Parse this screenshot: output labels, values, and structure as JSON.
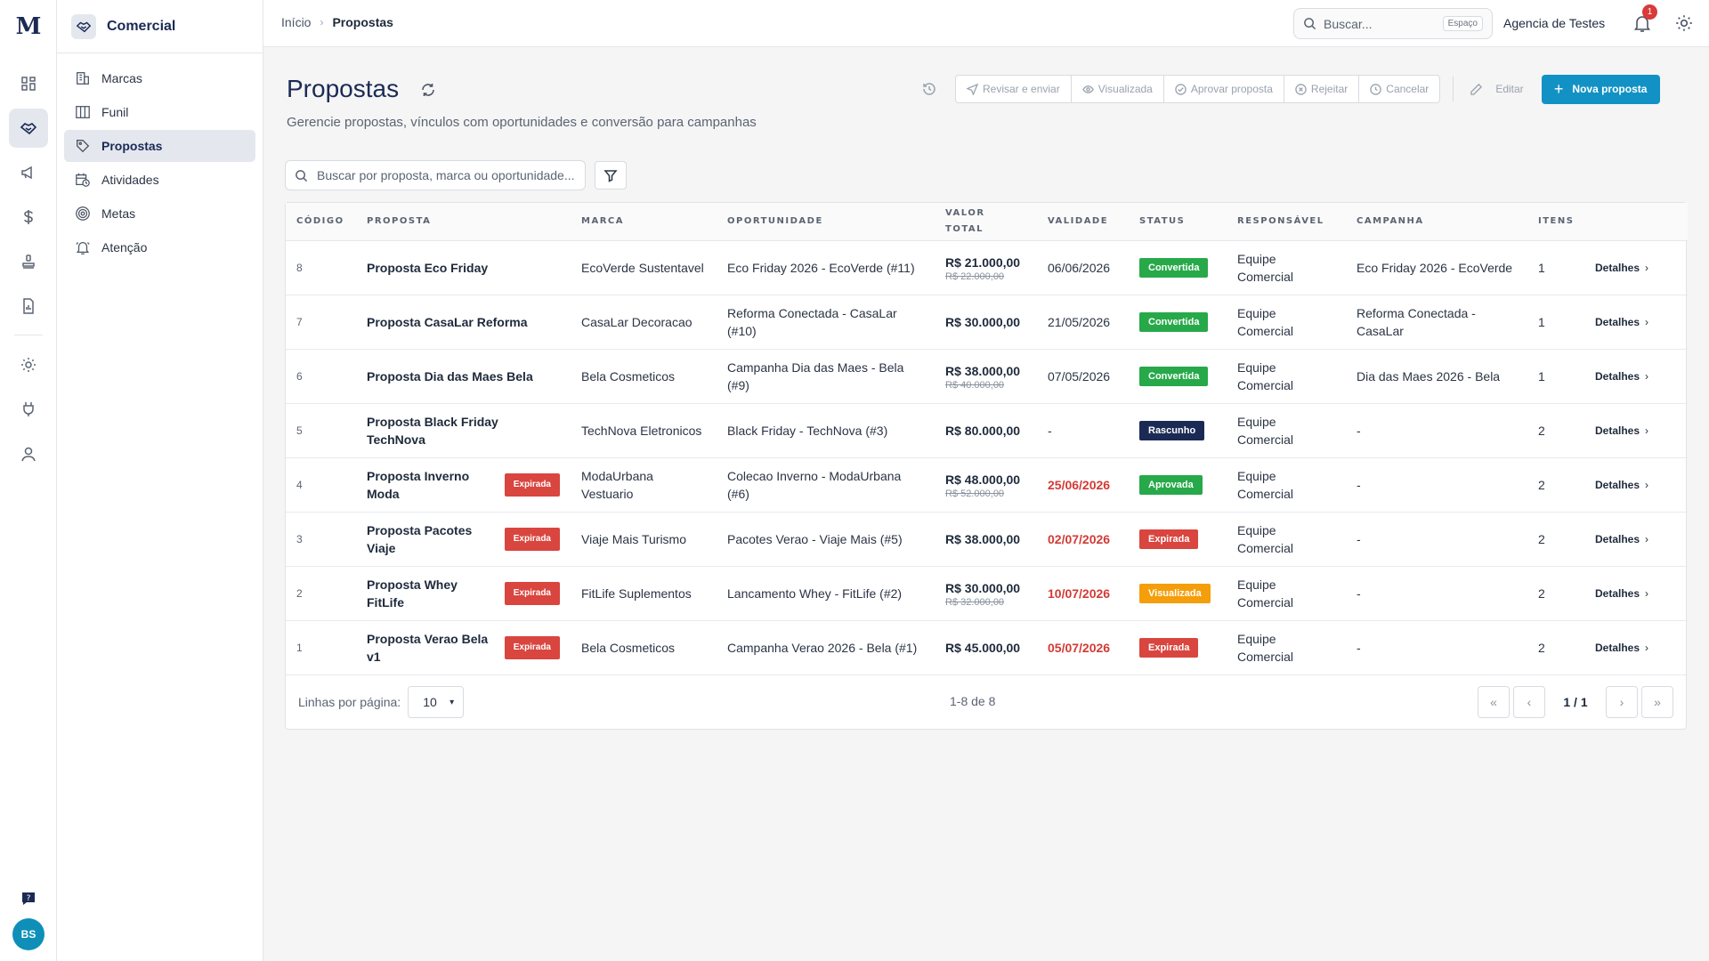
{
  "app": {
    "logo_letter": "M",
    "module_title": "Comercial",
    "avatar_initials": "BS"
  },
  "sidebar": {
    "items": [
      {
        "label": "Marcas",
        "icon": "building-icon",
        "active": false
      },
      {
        "label": "Funil",
        "icon": "columns-icon",
        "active": false
      },
      {
        "label": "Propostas",
        "icon": "tag-icon",
        "active": true
      },
      {
        "label": "Atividades",
        "icon": "calendar-clock-icon",
        "active": false
      },
      {
        "label": "Metas",
        "icon": "target-icon",
        "active": false
      },
      {
        "label": "Atenção",
        "icon": "bell-ring-icon",
        "active": false
      }
    ]
  },
  "topbar": {
    "breadcrumb": [
      "Início",
      "Propostas"
    ],
    "search_placeholder": "Buscar...",
    "search_shortcut": "Espaço",
    "agency": "Agencia de Testes",
    "notification_count": "1"
  },
  "page": {
    "title": "Propostas",
    "subtitle": "Gerencie propostas, vínculos com oportunidades e conversão para campanhas"
  },
  "actions": {
    "review": "Revisar e enviar",
    "viewed": "Visualizada",
    "approve": "Aprovar proposta",
    "reject": "Rejeitar",
    "cancel": "Cancelar",
    "edit": "Editar",
    "new": "Nova proposta"
  },
  "table_search": {
    "placeholder": "Buscar por proposta, marca ou oportunidade..."
  },
  "table": {
    "headers": {
      "code": "CÓDIGO",
      "proposal": "PROPOSTA",
      "brand": "MARCA",
      "opportunity": "OPORTUNIDADE",
      "total": "VALOR TOTAL",
      "validity": "VALIDADE",
      "status": "STATUS",
      "owner": "RESPONSÁVEL",
      "campaign": "CAMPANHA",
      "items": "ITENS"
    },
    "details_label": "Detalhes",
    "expired_tag": "Expirada",
    "rows": [
      {
        "code": "8",
        "name": "Proposta Eco Friday",
        "expired_tag": false,
        "brand": "EcoVerde Sustentavel",
        "opportunity": "Eco Friday 2026 - EcoVerde (#11)",
        "value": "R$ 21.000,00",
        "old_value": "R$ 22.000,00",
        "validity": "06/06/2026",
        "validity_red": false,
        "status": "Convertida",
        "status_class": "b-convertida",
        "owner": "Equipe Comercial",
        "campaign": "Eco Friday 2026 - EcoVerde",
        "items": "1"
      },
      {
        "code": "7",
        "name": "Proposta CasaLar Reforma",
        "expired_tag": false,
        "brand": "CasaLar Decoracao",
        "opportunity": "Reforma Conectada - CasaLar (#10)",
        "value": "R$ 30.000,00",
        "old_value": "",
        "validity": "21/05/2026",
        "validity_red": false,
        "status": "Convertida",
        "status_class": "b-convertida",
        "owner": "Equipe Comercial",
        "campaign": "Reforma Conectada - CasaLar",
        "items": "1"
      },
      {
        "code": "6",
        "name": "Proposta Dia das Maes Bela",
        "expired_tag": false,
        "brand": "Bela Cosmeticos",
        "opportunity": "Campanha Dia das Maes - Bela (#9)",
        "value": "R$ 38.000,00",
        "old_value": "R$ 40.000,00",
        "validity": "07/05/2026",
        "validity_red": false,
        "status": "Convertida",
        "status_class": "b-convertida",
        "owner": "Equipe Comercial",
        "campaign": "Dia das Maes 2026 - Bela",
        "items": "1"
      },
      {
        "code": "5",
        "name": "Proposta Black Friday TechNova",
        "expired_tag": false,
        "brand": "TechNova Eletronicos",
        "opportunity": "Black Friday - TechNova (#3)",
        "value": "R$ 80.000,00",
        "old_value": "",
        "validity": "-",
        "validity_red": false,
        "status": "Rascunho",
        "status_class": "b-rascunho",
        "owner": "Equipe Comercial",
        "campaign": "-",
        "items": "2"
      },
      {
        "code": "4",
        "name": "Proposta Inverno Moda",
        "expired_tag": true,
        "brand": "ModaUrbana Vestuario",
        "opportunity": "Colecao Inverno - ModaUrbana (#6)",
        "value": "R$ 48.000,00",
        "old_value": "R$ 52.000,00",
        "validity": "25/06/2026",
        "validity_red": true,
        "status": "Aprovada",
        "status_class": "b-aprovada",
        "owner": "Equipe Comercial",
        "campaign": "-",
        "items": "2"
      },
      {
        "code": "3",
        "name": "Proposta Pacotes Viaje",
        "expired_tag": true,
        "brand": "Viaje Mais Turismo",
        "opportunity": "Pacotes Verao - Viaje Mais (#5)",
        "value": "R$ 38.000,00",
        "old_value": "",
        "validity": "02/07/2026",
        "validity_red": true,
        "status": "Expirada",
        "status_class": "b-expirada",
        "owner": "Equipe Comercial",
        "campaign": "-",
        "items": "2"
      },
      {
        "code": "2",
        "name": "Proposta Whey FitLife",
        "expired_tag": true,
        "brand": "FitLife Suplementos",
        "opportunity": "Lancamento Whey - FitLife (#2)",
        "value": "R$ 30.000,00",
        "old_value": "R$ 32.000,00",
        "validity": "10/07/2026",
        "validity_red": true,
        "status": "Visualizada",
        "status_class": "b-visualizada",
        "owner": "Equipe Comercial",
        "campaign": "-",
        "items": "2"
      },
      {
        "code": "1",
        "name": "Proposta Verao Bela v1",
        "expired_tag": true,
        "brand": "Bela Cosmeticos",
        "opportunity": "Campanha Verao 2026 - Bela (#1)",
        "value": "R$ 45.000,00",
        "old_value": "",
        "validity": "05/07/2026",
        "validity_red": true,
        "status": "Expirada",
        "status_class": "b-expirada",
        "owner": "Equipe Comercial",
        "campaign": "-",
        "items": "2"
      }
    ]
  },
  "pagination": {
    "rows_label": "Linhas por página:",
    "rows_value": "10",
    "range": "1-8 de 8",
    "page_info": "1 / 1"
  }
}
